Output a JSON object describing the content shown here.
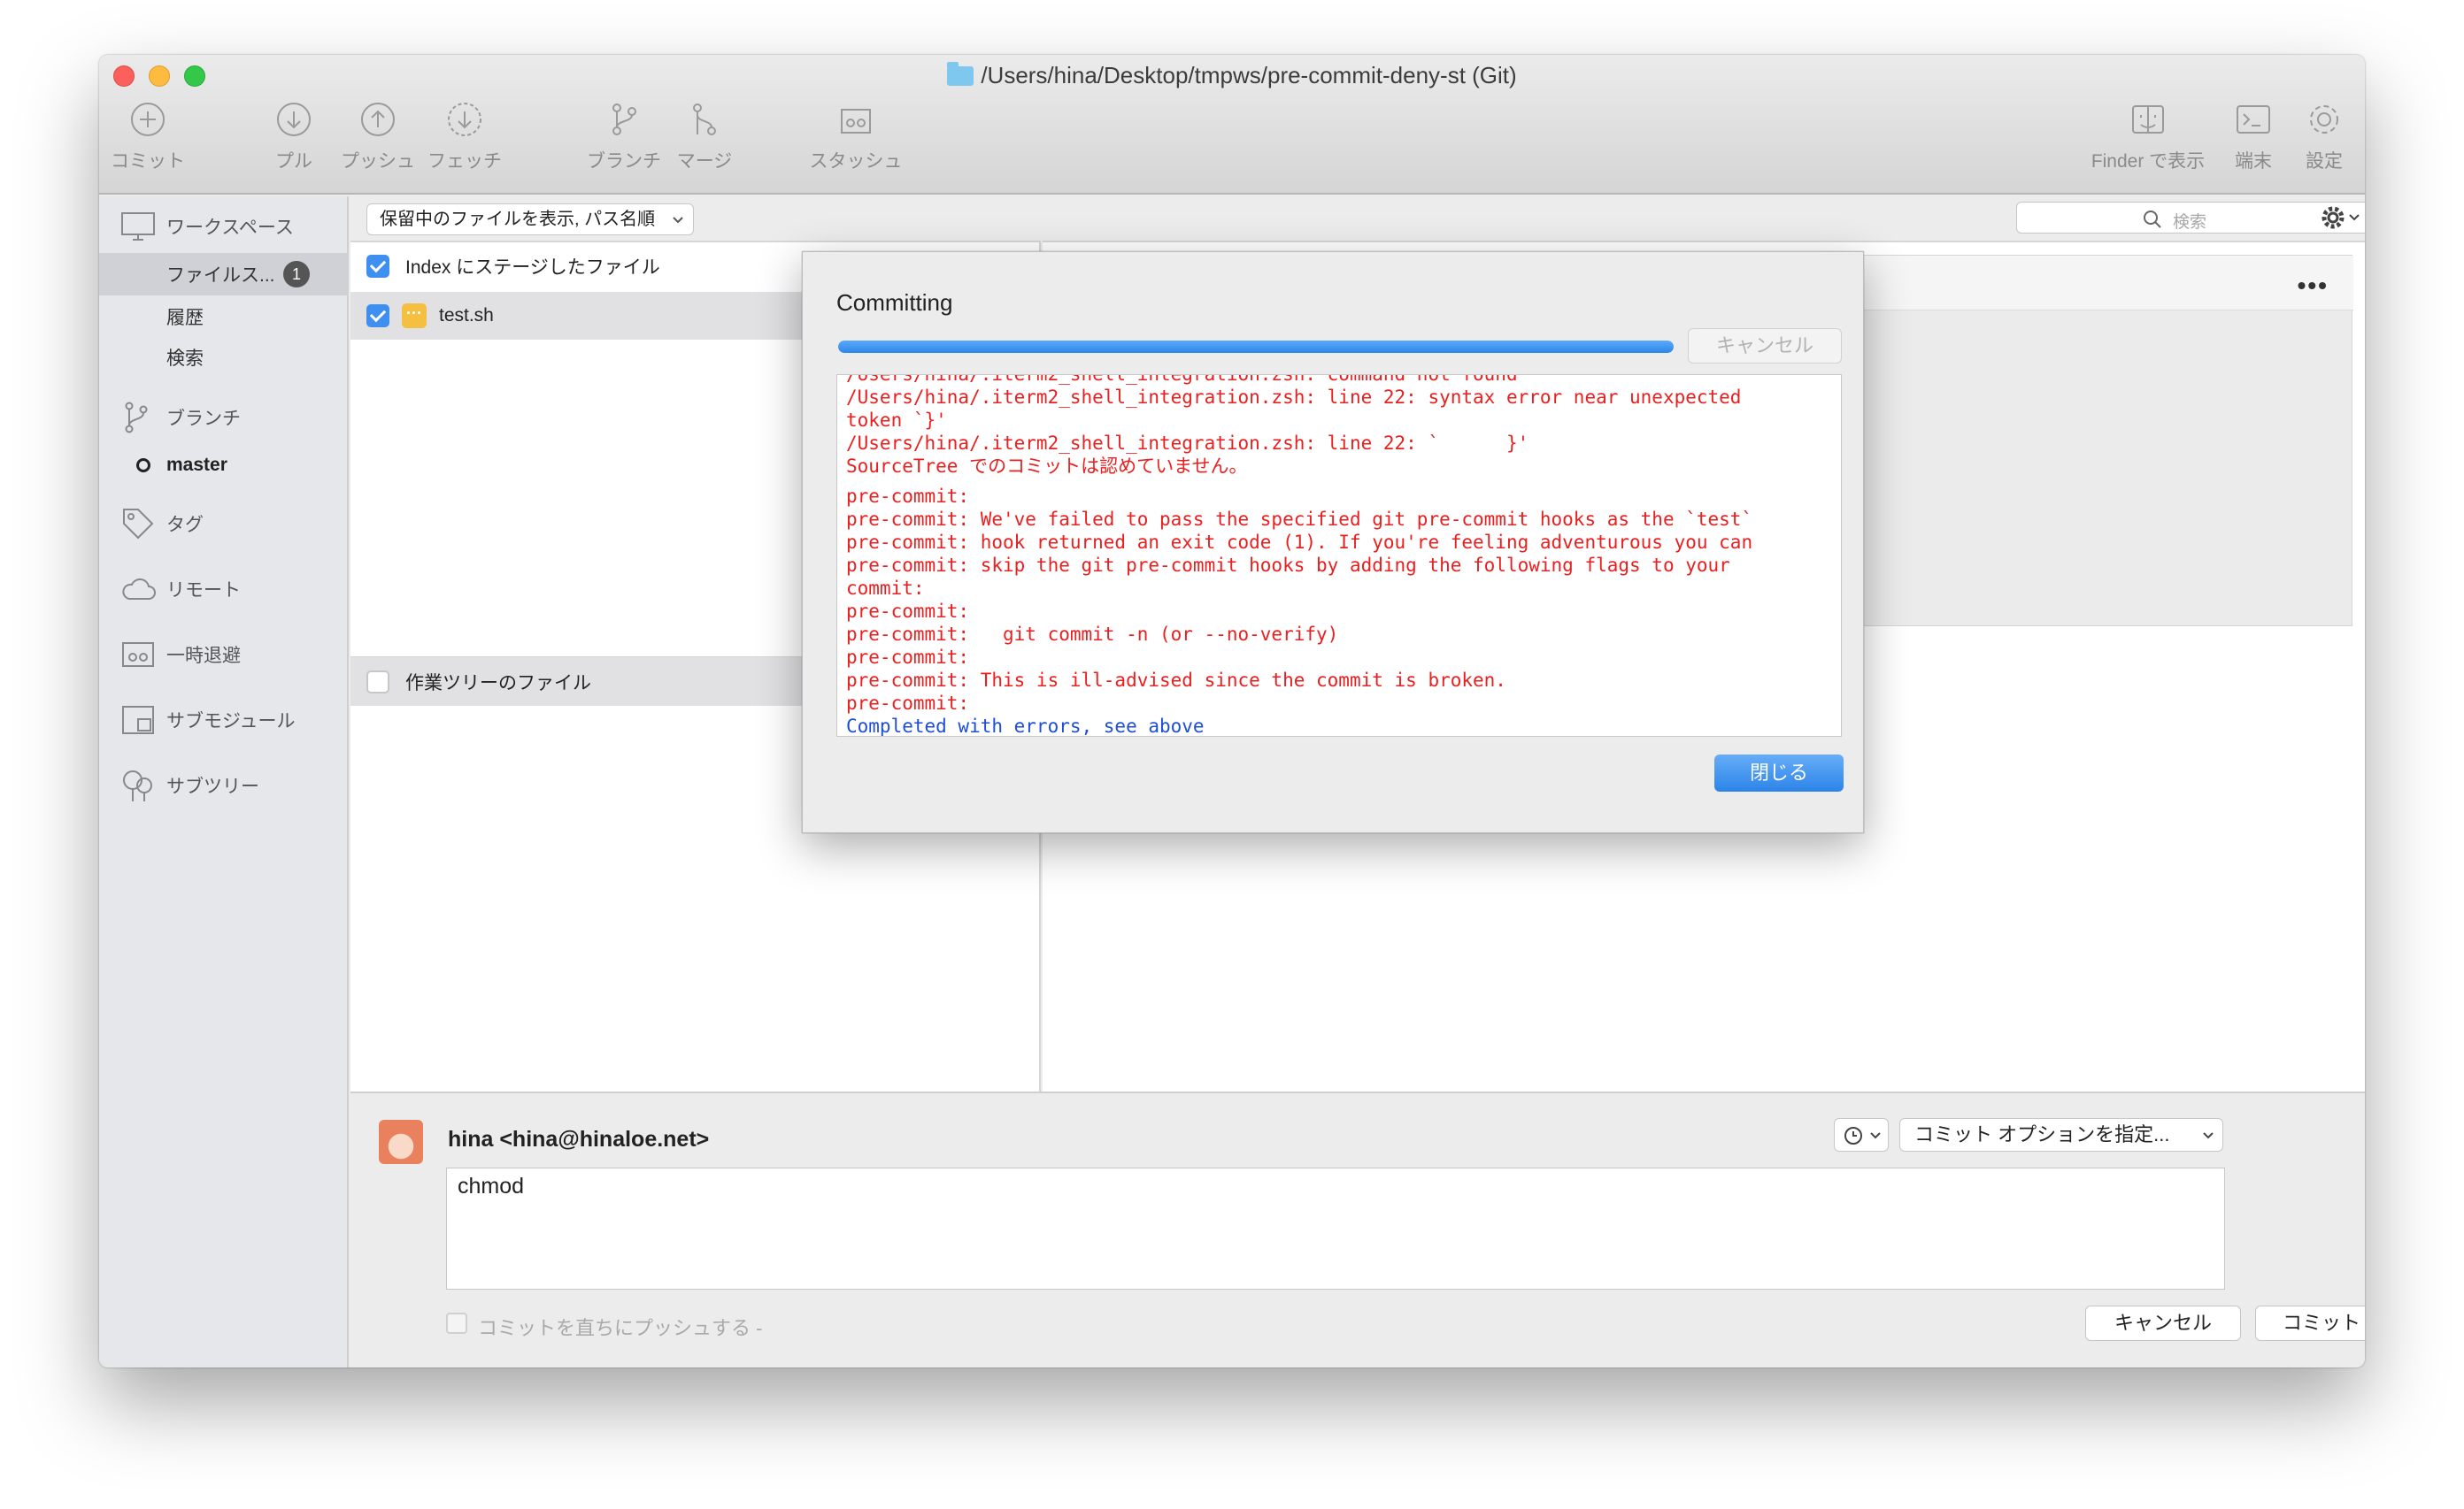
{
  "window": {
    "title": "/Users/hina/Desktop/tmpws/pre-commit-deny-st (Git)"
  },
  "toolbar": {
    "commit": "コミット",
    "pull": "プル",
    "push": "プッシュ",
    "fetch": "フェッチ",
    "branch": "ブランチ",
    "merge": "マージ",
    "stash": "スタッシュ",
    "finder": "Finder で表示",
    "terminal": "端末",
    "settings": "設定"
  },
  "sidebar": {
    "workspace": "ワークスペース",
    "file_status": "ファイルス...",
    "file_status_count": "1",
    "history": "履歴",
    "search": "検索",
    "branches": "ブランチ",
    "current_branch": "master",
    "tags": "タグ",
    "remotes": "リモート",
    "stashes": "一時退避",
    "submodules": "サブモジュール",
    "subtrees": "サブツリー"
  },
  "file_panel": {
    "view_option": "保留中のファイルを表示, パス名順",
    "staged_header": "Index にステージしたファイル",
    "staged_files": [
      "test.sh"
    ],
    "working_tree_header": "作業ツリーのファイル"
  },
  "right_panel": {
    "search_placeholder": "検索"
  },
  "commit_area": {
    "author": "hina <hina@hinaloe.net>",
    "options_label": "コミット オプションを指定...",
    "message": "chmod",
    "push_immediately": "コミットを直ちにプッシュする -",
    "cancel": "キャンセル",
    "commit": "コミット"
  },
  "dialog": {
    "title": "Committing",
    "progress": 1.0,
    "cancel": "キャンセル",
    "close": "閉じる",
    "log_lines": [
      "/Users/hina/.iterm2_shell_integration.zsh: line 22: syntax error near unexpected",
      "token `}'",
      "/Users/hina/.iterm2_shell_integration.zsh: line 22: `      }'",
      "SourceTree でのコミットは認めていません。",
      "",
      "pre-commit:",
      "pre-commit: We've failed to pass the specified git pre-commit hooks as the `test`",
      "pre-commit: hook returned an exit code (1). If you're feeling adventurous you can",
      "pre-commit: skip the git pre-commit hooks by adding the following flags to your",
      "commit:",
      "pre-commit:",
      "pre-commit:   git commit -n (or --no-verify)",
      "pre-commit:",
      "pre-commit: This is ill-advised since the commit is broken.",
      "pre-commit:"
    ],
    "completed": "Completed with errors, see above"
  },
  "colors": {
    "accent": "#3e8ff0",
    "error_text": "#ea1f1f",
    "info_text": "#1d4ed8"
  }
}
